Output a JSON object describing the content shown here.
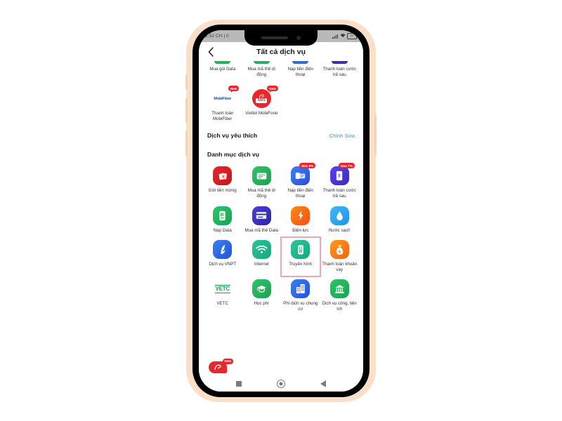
{
  "device": {
    "frame_color": "#fbdfc8",
    "bezel_color": "#000000"
  },
  "status_bar": {
    "time": "2:52 CH | 0",
    "battery_text": "91",
    "icons": [
      "signal-icon",
      "wifi-icon",
      "battery-icon"
    ]
  },
  "header": {
    "back_icon": "chevron-left-icon",
    "title": "Tất cả dịch vụ"
  },
  "cut_off_row": [
    {
      "label": "Mua gói Data",
      "color": "#27b262"
    },
    {
      "label": "Mua mã thẻ di động",
      "color": "#27b262"
    },
    {
      "label": "Nạp tiền điện thoại",
      "color": "#2f6bdc"
    },
    {
      "label": "Thanh toán cước trả sau",
      "color": "#3b2fb6"
    }
  ],
  "promo_row": [
    {
      "label": "Thanh toán MobiFiber",
      "badge": "New",
      "logo_text": "MobiFiber",
      "icon": "mobifiber-logo-icon"
    },
    {
      "label": "Viettel MobiFone",
      "badge": "New",
      "logo_text": "SMS",
      "icon": "viettel-sms-icon"
    }
  ],
  "favorites_section": {
    "title": "Dịch vụ yêu thích",
    "action": "Chỉnh Sửa"
  },
  "catalog_section": {
    "title": "Danh mục dịch vụ"
  },
  "services": [
    {
      "label": "Gửi tiền mừng",
      "icon": "money-envelope-icon",
      "color1": "#e8262b",
      "color2": "#c4161c",
      "badge": null
    },
    {
      "label": "Mua mã thẻ di động",
      "icon": "card-code-icon",
      "color1": "#2fc46a",
      "color2": "#17a44f",
      "badge": null
    },
    {
      "label": "Nạp tiền điện thoại",
      "icon": "phone-topup-icon",
      "color1": "#3f7ff0",
      "color2": "#2a4fd6",
      "badge": "Max 8%"
    },
    {
      "label": "Thanh toán cước trả sau",
      "icon": "postpaid-bill-icon",
      "color1": "#5a44e8",
      "color2": "#3a2bc4",
      "badge": "Max 7%"
    },
    {
      "label": "Nạp Data",
      "icon": "data-topup-icon",
      "color1": "#2fc46a",
      "color2": "#17a44f",
      "badge": null
    },
    {
      "label": "Mua mã thẻ Data",
      "icon": "data-card-icon",
      "color1": "#4b3fd6",
      "color2": "#2e25a8",
      "badge": null
    },
    {
      "label": "Điện lực",
      "icon": "electricity-icon",
      "color1": "#ff8a15",
      "color2": "#f24e16",
      "badge": null
    },
    {
      "label": "Nước sạch",
      "icon": "water-drop-icon",
      "color1": "#45b8f5",
      "color2": "#1f93e6",
      "badge": null
    },
    {
      "label": "Dịch vụ VNPT",
      "icon": "vnpt-icon",
      "color1": "#3b7ff0",
      "color2": "#2254d8",
      "badge": null
    },
    {
      "label": "Internet",
      "icon": "wifi-icon",
      "color1": "#2fc49a",
      "color2": "#16a87f",
      "badge": null
    },
    {
      "label": "Truyền hình",
      "icon": "tv-remote-icon",
      "color1": "#2fc49a",
      "color2": "#16a87f",
      "badge": null,
      "highlighted": true
    },
    {
      "label": "Thanh toán khoản vay",
      "icon": "loan-money-bag-icon",
      "color1": "#ff9b1a",
      "color2": "#f2601a",
      "badge": null
    },
    {
      "label": "VETC",
      "icon": "vetc-logo-icon",
      "color1": "#ffffff",
      "color2": "#ffffff",
      "badge": null,
      "text_logo": "VETC"
    },
    {
      "label": "Học phí",
      "icon": "graduation-cap-icon",
      "color1": "#2fc46a",
      "color2": "#17a44f",
      "badge": null
    },
    {
      "label": "Phí dịch vụ chung cư",
      "icon": "apartment-icon",
      "color1": "#3b7ff0",
      "color2": "#2254d8",
      "badge": null
    },
    {
      "label": "Dịch vụ công, tiện ích",
      "icon": "public-service-icon",
      "color1": "#2fc46a",
      "color2": "#17a44f",
      "badge": null
    }
  ],
  "floating_bubble": {
    "badge": "New",
    "icon": "viettel-logo-icon"
  },
  "nav_bar": {
    "recents_icon": "square-icon",
    "home_icon": "circle-icon",
    "back_icon": "triangle-back-icon"
  },
  "highlight": {
    "color": "#e7a9b4",
    "target_label": "Truyền hình"
  }
}
